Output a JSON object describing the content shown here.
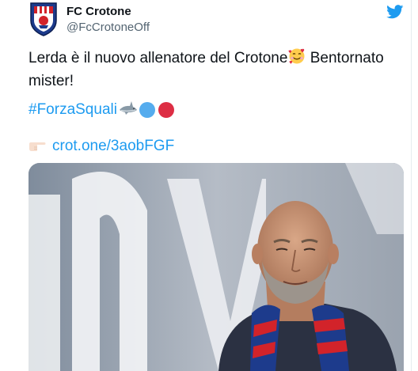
{
  "author": {
    "name": "FC Crotone",
    "handle": "@FcCrotoneOff",
    "avatar_icon": "crotone-crest-icon"
  },
  "platform_icon": "twitter-bird-icon",
  "tweet": {
    "text": "Lerda è il nuovo allenatore del Crotone",
    "text_emoji": "smiling-face-with-hearts-icon",
    "text_after": " Bentornato mister!",
    "hashtag": "#ForzaSquali",
    "hashtag_emojis": [
      "shark-icon",
      "blue-circle-icon",
      "red-circle-icon"
    ],
    "link_icon": "backhand-index-pointing-right-icon",
    "link_text": "crot.one/3aobFGF"
  },
  "colors": {
    "link_blue": "#1d9bf0",
    "twitter_blue": "#1d9bf0",
    "text": "#0f1419",
    "handle_gray": "#536471",
    "crotone_red": "#d2232a",
    "crotone_blue": "#1d3b8c"
  }
}
